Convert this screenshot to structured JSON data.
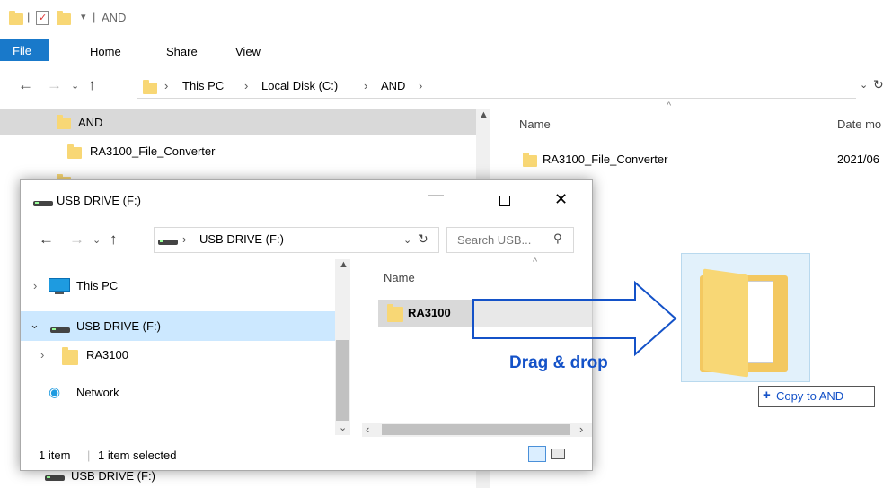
{
  "main": {
    "title": "AND",
    "tabs": [
      "File",
      "Home",
      "Share",
      "View"
    ],
    "breadcrumb": [
      "This PC",
      "Local Disk (C:)",
      "AND"
    ],
    "tree": [
      "AND",
      "RA3100_File_Converter",
      "USB DRIVE (F:)"
    ],
    "col_name": "Name",
    "col_date": "Date mo",
    "file_name": "RA3100_File_Converter",
    "file_date": "2021/06"
  },
  "usb": {
    "title": "USB DRIVE (F:)",
    "breadcrumb": "USB DRIVE (F:)",
    "search_placeholder": "Search USB...",
    "tree": [
      "This PC",
      "USB DRIVE (F:)",
      "RA3100",
      "Network"
    ],
    "col_name": "Name",
    "file_name": "RA3100",
    "status_items": "1 item",
    "status_selected": "1 item selected"
  },
  "annotation": {
    "drag_text": "Drag & drop",
    "copy_tooltip": "Copy to AND"
  },
  "colors": {
    "accent": "#1979ca",
    "file_tab": "#1979ca",
    "selected": "#cce8ff",
    "arrow": "#1452c8"
  }
}
